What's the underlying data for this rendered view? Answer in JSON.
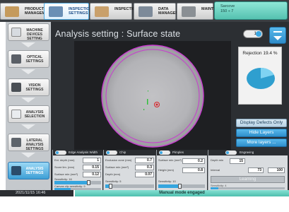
{
  "top_tabs": [
    {
      "label": "PRODUCT MANAGEMENT",
      "icon": "product-box-icon"
    },
    {
      "label": "INSPECTION SETTINGS",
      "icon": "inspection-settings-icon"
    },
    {
      "label": "INSPECTION",
      "icon": "inspection-icon"
    },
    {
      "label": "DATA MANAGEMENT",
      "icon": "data-chart-icon"
    },
    {
      "label": "MAINTENANCE",
      "icon": "tools-icon"
    }
  ],
  "meter": {
    "label": "Sarcove",
    "value": "150 ÷ 7"
  },
  "sidebar": {
    "items": [
      {
        "label": "MACHINE DEVICES SETTING",
        "icon": "machine-icon"
      },
      {
        "label": "OPTICAL SETTINGS",
        "icon": "camera-icon"
      },
      {
        "label": "VISION SETTINGS",
        "icon": "vision-icon"
      },
      {
        "label": "ANALYSIS SELECTION",
        "icon": "analysis-list-icon"
      },
      {
        "label": "LATERAL ANALYSIS SETTINGS",
        "icon": "lateral-icon"
      },
      {
        "label": "ANALYSIS SETTINGS",
        "icon": "analysis-settings-icon"
      }
    ]
  },
  "main": {
    "title": "Analysis setting : Surface state",
    "toggle_label": "1",
    "rejection": {
      "label": "Rejection 19.4 %",
      "percent": 19.4
    },
    "buttons": {
      "display_defects": "Display Defects Only",
      "hide_layers": "Hide Layers",
      "more_layers": "More layers ..."
    }
  },
  "panels": {
    "edge": {
      "title": "Edge Analysis Width",
      "fields": [
        {
          "label": "Ext. depth (mm)",
          "value": "1"
        },
        {
          "label": "Score lim. (mm)",
          "value": "0.15"
        },
        {
          "label": "Surface min (mm²)",
          "value": "0.12"
        }
      ],
      "sensitivity_label": "Sensitivity: 16",
      "sensitivity": 0.72,
      "canvas_label": "Canvas clip sensitivity: 9",
      "canvas_sensitivity": 0.35
    },
    "chip": {
      "title": "Chip",
      "fields": [
        {
          "label": "Exclusion zone (mm)",
          "value": "0.7"
        },
        {
          "label": "Surface min (mm²)",
          "value": "0.3"
        },
        {
          "label": "Depth (mm)",
          "value": "0.07"
        }
      ],
      "sensitivity_label": "Sensitivity: 5",
      "sensitivity": 0.1
    },
    "pimples": {
      "title": "Pimples",
      "fields": [
        {
          "label": "Surface min (mm²)",
          "value": "0.2"
        },
        {
          "label": "Height (mm)",
          "value": "0.8"
        }
      ],
      "sensitivity_label": "Sensitivity: 10",
      "sensitivity": 0.45
    },
    "engraving": {
      "title": "Engraving",
      "depth_label": "Depth min",
      "depth_value": "15",
      "interval_label": "Interval",
      "interval_min": "73",
      "interval_max": "100",
      "learning_label": "Learning",
      "sensitivity_label": "Sensitivity: 4",
      "sensitivity": 0.1
    }
  },
  "status": {
    "datetime": "2021/11/15 16:46",
    "mode": "Manual mode engaged"
  },
  "colors": {
    "accent": "#3aa7e3",
    "meter": "#55c2b0",
    "panel_dark": "#2c2f33",
    "pie": "#3fb7e6"
  }
}
